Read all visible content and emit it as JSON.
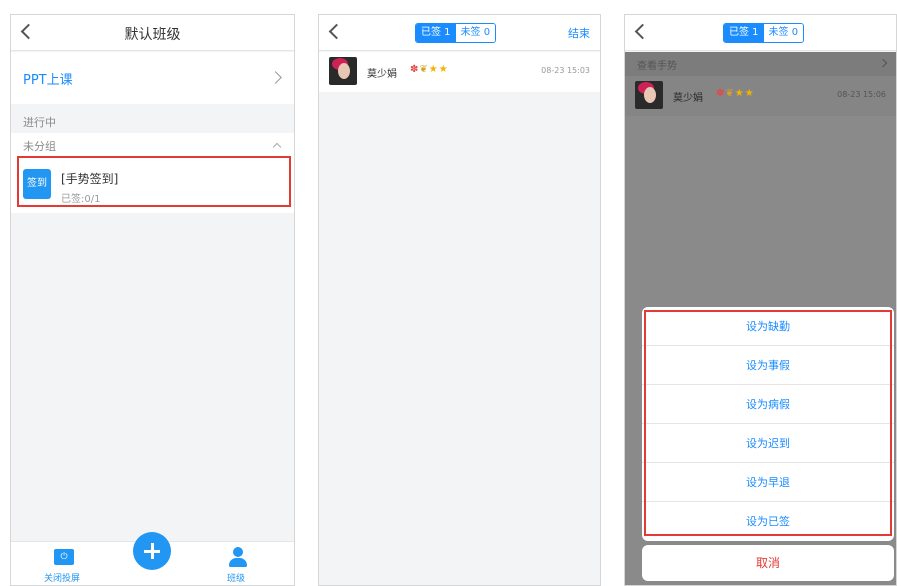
{
  "screen1": {
    "title": "默认班级",
    "ppt_label": "PPT上课",
    "section_in_progress": "进行中",
    "group_label": "未分组",
    "activity": {
      "badge": "签到",
      "title": "[手势签到]",
      "subtitle": "已签:0/1"
    },
    "bottom": {
      "close_projection": "关闭投屏",
      "class": "班级"
    }
  },
  "screen2": {
    "tabs": {
      "signed": "已签 1",
      "unsigned": "未签 0"
    },
    "end_label": "结束",
    "student": {
      "name": "莫少娟",
      "medals": "✽ ❦ ★★",
      "time": "08-23 15:03"
    }
  },
  "screen3": {
    "tabs": {
      "signed": "已签 1",
      "unsigned": "未签 0"
    },
    "sub_label": "查看手势",
    "student": {
      "name": "莫少娟",
      "medals": "✽ ❦ ★★",
      "time": "08-23 15:06"
    },
    "actions": [
      "设为缺勤",
      "设为事假",
      "设为病假",
      "设为迟到",
      "设为早退",
      "设为已签"
    ],
    "cancel": "取消"
  },
  "colors": {
    "accent": "#1a8cff",
    "highlight": "#e53935",
    "badge": "#2196f3"
  },
  "icons": [
    "back-chevron-icon",
    "chevron-right-icon",
    "chevron-up-icon",
    "screen-icon",
    "plus-icon",
    "person-icon"
  ]
}
